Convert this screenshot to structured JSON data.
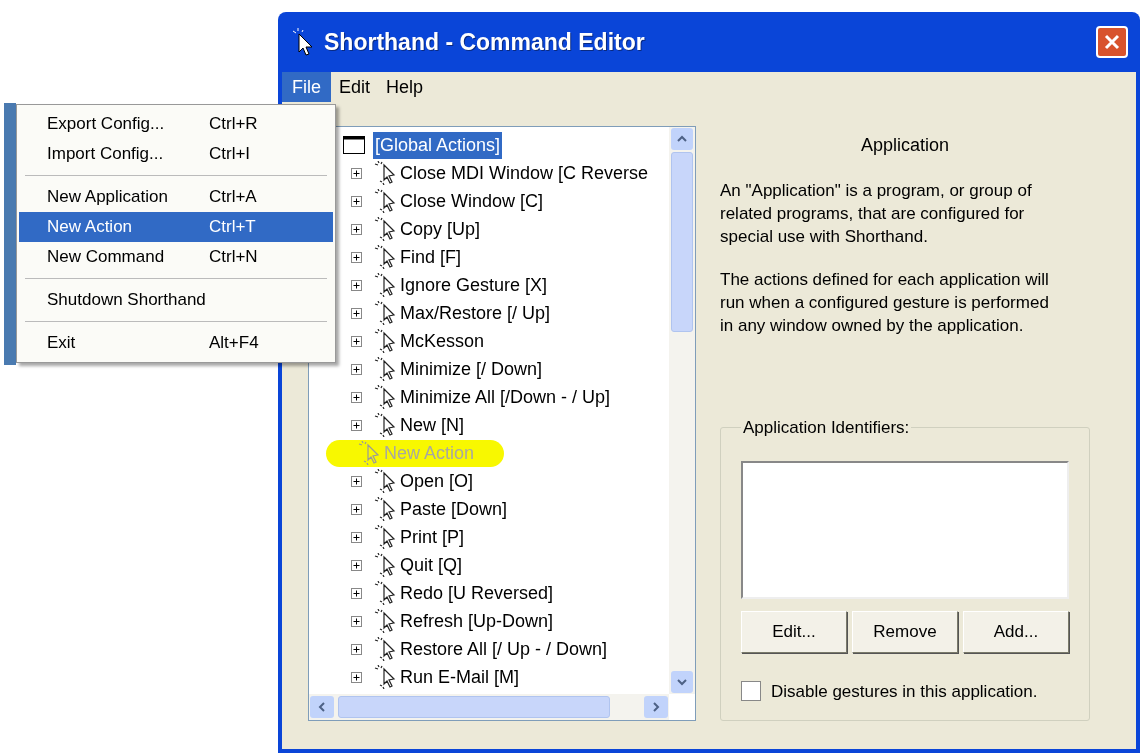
{
  "window": {
    "title": "Shorthand - Command Editor"
  },
  "menu_bar": [
    {
      "label": "File",
      "selected": true
    },
    {
      "label": "Edit",
      "selected": false
    },
    {
      "label": "Help",
      "selected": false
    }
  ],
  "file_menu": [
    {
      "kind": "item",
      "label": "Export Config...",
      "shortcut": "Ctrl+R",
      "selected": false
    },
    {
      "kind": "item",
      "label": "Import Config...",
      "shortcut": "Ctrl+I",
      "selected": false
    },
    {
      "kind": "separator"
    },
    {
      "kind": "item",
      "label": "New Application",
      "shortcut": "Ctrl+A",
      "selected": false
    },
    {
      "kind": "item",
      "label": "New Action",
      "shortcut": "Ctrl+T",
      "selected": true
    },
    {
      "kind": "item",
      "label": "New Command",
      "shortcut": "Ctrl+N",
      "selected": false
    },
    {
      "kind": "separator"
    },
    {
      "kind": "item",
      "label": "Shutdown Shorthand",
      "selected": false
    },
    {
      "kind": "separator"
    },
    {
      "kind": "item",
      "label": "Exit",
      "shortcut": "Alt+F4",
      "selected": false
    }
  ],
  "tree": {
    "label": "[Global Actions]",
    "selected": true,
    "children": [
      {
        "label": "Close MDI Window [C Reverse",
        "expandable": true,
        "dimmed": false,
        "highlighted": false
      },
      {
        "label": "Close Window [C]",
        "expandable": true,
        "dimmed": false,
        "highlighted": false
      },
      {
        "label": "Copy [Up]",
        "expandable": true,
        "dimmed": false,
        "highlighted": false
      },
      {
        "label": "Find [F]",
        "expandable": true,
        "dimmed": false,
        "highlighted": false
      },
      {
        "label": "Ignore Gesture [X]",
        "expandable": true,
        "dimmed": false,
        "highlighted": false
      },
      {
        "label": "Max/Restore [/ Up]",
        "expandable": true,
        "dimmed": false,
        "highlighted": false
      },
      {
        "label": "McKesson",
        "expandable": true,
        "dimmed": false,
        "highlighted": false
      },
      {
        "label": "Minimize [/ Down]",
        "expandable": true,
        "dimmed": false,
        "highlighted": false
      },
      {
        "label": "Minimize All [/Down - / Up]",
        "expandable": true,
        "dimmed": false,
        "highlighted": false
      },
      {
        "label": "New [N]",
        "expandable": true,
        "dimmed": false,
        "highlighted": false
      },
      {
        "label": "New Action",
        "expandable": false,
        "dimmed": true,
        "highlighted": true
      },
      {
        "label": "Open [O]",
        "expandable": true,
        "dimmed": false,
        "highlighted": false
      },
      {
        "label": "Paste [Down]",
        "expandable": true,
        "dimmed": false,
        "highlighted": false
      },
      {
        "label": "Print [P]",
        "expandable": true,
        "dimmed": false,
        "highlighted": false
      },
      {
        "label": "Quit [Q]",
        "expandable": true,
        "dimmed": false,
        "highlighted": false
      },
      {
        "label": "Redo [U Reversed]",
        "expandable": true,
        "dimmed": false,
        "highlighted": false
      },
      {
        "label": "Refresh [Up-Down]",
        "expandable": true,
        "dimmed": false,
        "highlighted": false
      },
      {
        "label": "Restore All [/ Up - / Down]",
        "expandable": true,
        "dimmed": false,
        "highlighted": false
      },
      {
        "label": "Run E-Mail [M]",
        "expandable": true,
        "dimmed": false,
        "highlighted": false
      }
    ]
  },
  "details": {
    "heading": "Application",
    "paragraphs": [
      "An \"Application\" is a program, or group of related programs, that are configured for special use with Shorthand.",
      "The actions defined for each application will run when a configured gesture is performed in any window owned by the application."
    ],
    "group_title": "Application Identifiers:",
    "buttons": [
      "Edit...",
      "Remove",
      "Add..."
    ],
    "checkbox": {
      "label": "Disable gestures in this application.",
      "checked": false
    }
  }
}
